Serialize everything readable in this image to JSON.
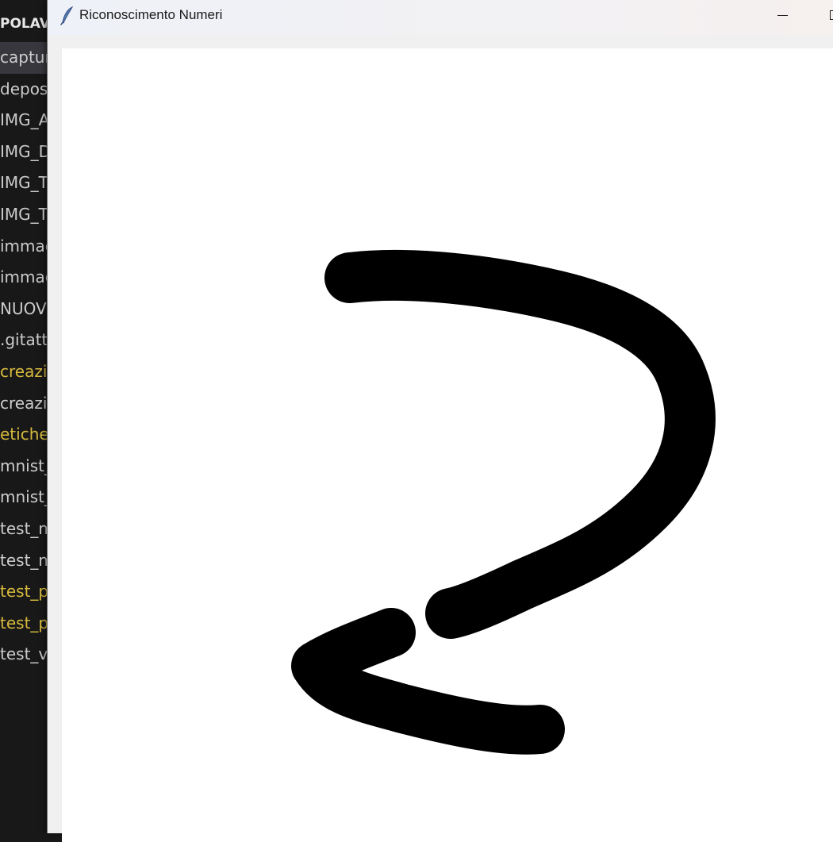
{
  "explorer": {
    "header": "POLAV",
    "items": [
      {
        "label": "captur",
        "color": "#cccccc"
      },
      {
        "label": "depos",
        "color": "#cccccc"
      },
      {
        "label": "IMG_A",
        "color": "#cccccc"
      },
      {
        "label": "IMG_D",
        "color": "#cccccc"
      },
      {
        "label": "IMG_T",
        "color": "#cccccc"
      },
      {
        "label": "IMG_T",
        "color": "#cccccc"
      },
      {
        "label": "immag",
        "color": "#cccccc"
      },
      {
        "label": "immag",
        "color": "#cccccc"
      },
      {
        "label": "NUOV",
        "color": "#cccccc"
      },
      {
        "label": ".gitatt",
        "color": "#cccccc"
      },
      {
        "label": "creazi",
        "color": "#d7ba3d"
      },
      {
        "label": "creazi",
        "color": "#cccccc"
      },
      {
        "label": "etiche",
        "color": "#d7ba3d"
      },
      {
        "label": "mnist_",
        "color": "#cccccc"
      },
      {
        "label": "mnist_",
        "color": "#cccccc"
      },
      {
        "label": "test_m",
        "color": "#cccccc"
      },
      {
        "label": "test_m",
        "color": "#cccccc"
      },
      {
        "label": "test_p",
        "color": "#d7ba3d"
      },
      {
        "label": "test_p",
        "color": "#d7ba3d"
      },
      {
        "label": "test_v",
        "color": "#cccccc"
      }
    ]
  },
  "window": {
    "title": "Riconoscimento Numeri",
    "icon": "feather-icon"
  },
  "canvas": {
    "content": "handwritten digit drawing",
    "stroke_color": "#000000",
    "background_color": "#ffffff"
  }
}
